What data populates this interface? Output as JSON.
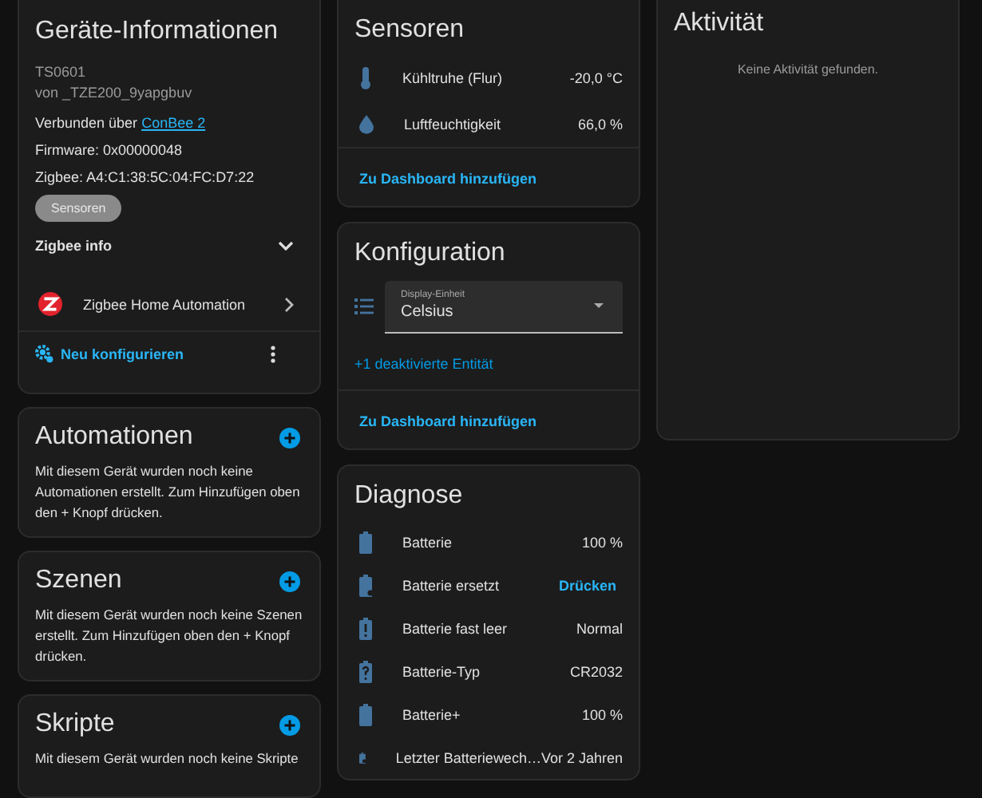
{
  "device_info": {
    "title": "Geräte-Informationen",
    "model": "TS0601",
    "manufacturer": "von _TZE200_9yapgbuv",
    "connected_label": "Verbunden über",
    "connected_link": "ConBee 2",
    "firmware": "Firmware: 0x00000048",
    "zigbee": "Zigbee: A4:C1:38:5C:04:FC:D7:22",
    "area_chip": "Sensoren",
    "zigbee_info": {
      "label": "Zigbee info",
      "expanded": false
    },
    "integration": "Zigbee Home Automation",
    "reconfigure": "Neu konfigurieren"
  },
  "automations": {
    "title": "Automationen",
    "text": "Mit diesem Gerät wurden noch keine Automationen erstellt. Zum Hinzufügen oben den + Knopf drücken."
  },
  "scenes": {
    "title": "Szenen",
    "text": "Mit diesem Gerät wurden noch keine Szenen erstellt. Zum Hinzufügen oben den + Knopf drücken."
  },
  "scripts": {
    "title": "Skripte",
    "text": "Mit diesem Gerät wurden noch keine Skripte"
  },
  "sensors": {
    "title": "Sensoren",
    "rows": [
      {
        "kind": "thermometer",
        "name": "Kühltruhe (Flur)",
        "value": "-20,0 °C"
      },
      {
        "kind": "humidity",
        "name": "Luftfeuchtigkeit",
        "value": "66,0 %"
      }
    ],
    "add_link": "Zu Dashboard hinzufügen"
  },
  "configuration": {
    "title": "Konfiguration",
    "select_label": "Display-Einheit",
    "select_value": "Celsius",
    "disabled_entities": "+1 deaktivierte Entität",
    "add_link": "Zu Dashboard hinzufügen"
  },
  "diagnostics": {
    "title": "Diagnose",
    "rows": [
      {
        "kind": "battery",
        "name": "Batterie",
        "value": "100 %"
      },
      {
        "kind": "battery-sync",
        "name": "Batterie ersetzt",
        "button": "Drücken"
      },
      {
        "kind": "battery-alert",
        "name": "Batterie fast leer",
        "value": "Normal"
      },
      {
        "kind": "battery-question",
        "name": "Batterie-Typ",
        "value": "CR2032"
      },
      {
        "kind": "battery",
        "name": "Batterie+",
        "value": "100 %"
      },
      {
        "kind": "battery-clock",
        "name": "Letzter Batteriewech…",
        "value": "Vor 2 Jahren"
      }
    ]
  },
  "activity": {
    "title": "Aktivität",
    "empty": "Keine Aktivität gefunden."
  }
}
